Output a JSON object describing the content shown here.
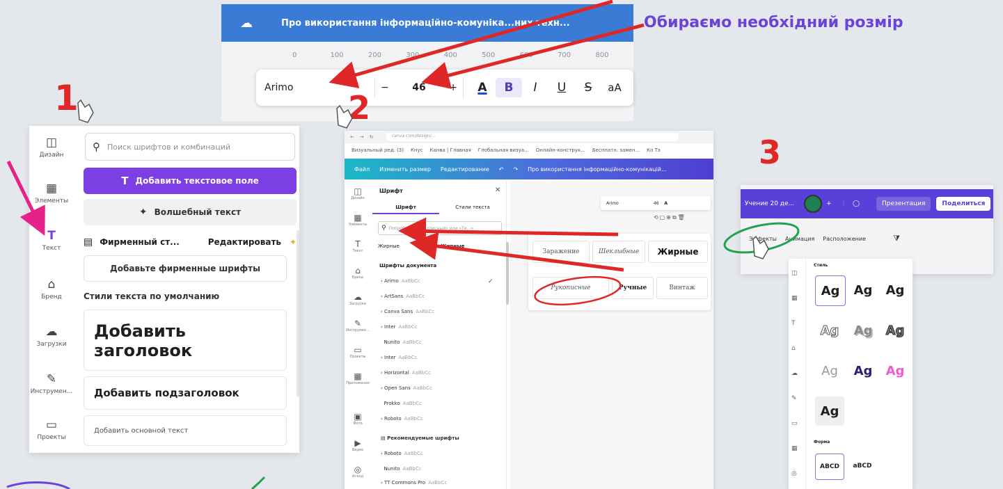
{
  "caption": "Обираємо необхідний розмір",
  "steps": {
    "one": "1",
    "two": "2",
    "three": "3"
  },
  "top_toolbar": {
    "title": "Про використання інформаційно-комуніка...них техн...",
    "ruler": [
      "0",
      "100",
      "200",
      "300",
      "400",
      "500",
      "600",
      "700",
      "800"
    ],
    "font_name": "Arimo",
    "minus": "−",
    "size": "46",
    "plus": "+",
    "color_glyph": "A",
    "bold": "B",
    "italic": "I",
    "underline": "U",
    "strike": "S",
    "case": "aA"
  },
  "left_panel": {
    "rail": [
      {
        "label": "Дизайн",
        "icon": "design-icon"
      },
      {
        "label": "Элементы",
        "icon": "elements-icon"
      },
      {
        "label": "Текст",
        "icon": "text-icon"
      },
      {
        "label": "Бренд",
        "icon": "brand-icon"
      },
      {
        "label": "Загрузки",
        "icon": "uploads-icon"
      },
      {
        "label": "Инструмен...",
        "icon": "tools-icon"
      },
      {
        "label": "Проекты",
        "icon": "projects-icon"
      }
    ],
    "search_placeholder": "Поиск шрифтов и комбинаций",
    "add_text": "Добавить текстовое поле",
    "magic_text": "Волшебный текст",
    "brand_label": "Фирменный ст...",
    "brand_edit": "Редактировать",
    "add_brand_fonts": "Добавьте фирменные шрифты",
    "styles_heading": "Стили текста по умолчанию",
    "add_heading": "Добавить заголовок",
    "add_subheading": "Добавить подзаголовок",
    "add_body": "Добавить основной текст"
  },
  "browser": {
    "tab_text": "canva.com/design/...",
    "bookmarks": [
      "Визуальный ред. (3)",
      "Кнус",
      "Канва | Главная",
      "Глобальная визуа...",
      "Онлайн-конструк...",
      "Бесплатн. замен...",
      "Ко Тэ"
    ],
    "appbar": [
      "Файл",
      "Изменить размер",
      "Редактирование",
      "↶",
      "↷",
      "Про використання інформаційно-комунікацій..."
    ],
    "rail": [
      "Дизайн",
      "Элементы",
      "Текст",
      "Бренд",
      "Загрузки",
      "Инструмен...",
      "Проекты",
      "Приложения",
      "Фото",
      "Видео",
      "Ai-код"
    ],
    "panel_title": "Шрифт",
    "close": "✕",
    "tab_font": "Шрифт",
    "tab_styles": "Стили текста",
    "search_placeholder": "Попробуйте «Рукописный» или «Ти...»",
    "filter_a": "Жирные",
    "filter_b": "Жирные",
    "section_doc": "Шрифты документа",
    "fonts": [
      "Arimo",
      "ArtSans",
      "Canva Sans",
      "Inter",
      "Nunito",
      "Inter",
      "Horizontal",
      "Open Sans",
      "Prokko",
      "Roboto"
    ],
    "font_hint": "AaBbCc",
    "check": "✓",
    "section_recommended": "Рекомендуемые шрифты",
    "recommended": [
      "Roboto",
      "Nunito",
      "TT Commons Pro"
    ],
    "toolbar_font": "Arimo",
    "toolbar_size": "46",
    "chips": [
      "Заражение",
      "Шеклыбные",
      "Жирные",
      "Рукописные",
      "Ручные",
      "Винтаж"
    ]
  },
  "right_shot": {
    "doc_name": "Учение 20 де...",
    "present": "Презентация",
    "share": "Поделиться",
    "tab_effects": "Эффекты",
    "tab_animation": "Анимация",
    "tab_position": "Расположение",
    "filter_icon": "filter-icon",
    "styles_label": "Стиль",
    "ag": "Ag",
    "shapes_label": "Форма",
    "abcd_1": "ABCD",
    "abcd_2": "aBCD"
  },
  "colors": {
    "accent_purple": "#7b3fe4",
    "annotation_red": "#e02727",
    "caption_purple": "#6b43d8",
    "magenta_arrow": "#e6218a",
    "green_ring": "#23a24d"
  }
}
